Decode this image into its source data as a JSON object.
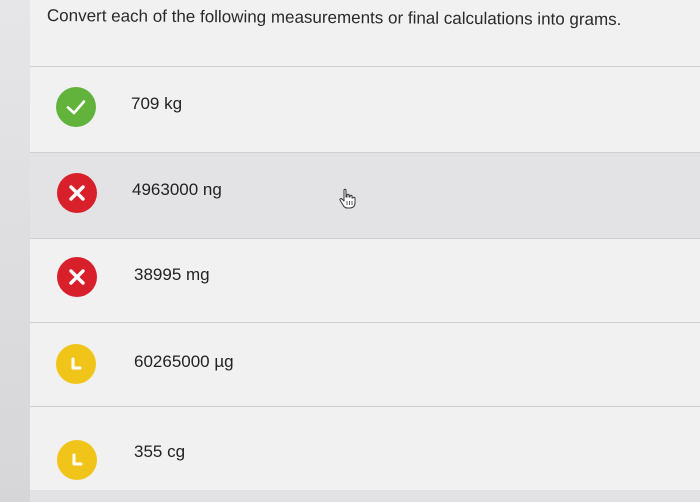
{
  "question": {
    "text": "Convert each of the following measurements or final calculations into grams."
  },
  "answers": [
    {
      "value": "709 kg",
      "status": "correct",
      "status_icon": "check-icon"
    },
    {
      "value": "4963000 ng",
      "status": "incorrect",
      "status_icon": "x-icon"
    },
    {
      "value": "38995 mg",
      "status": "incorrect",
      "status_icon": "x-icon"
    },
    {
      "value": "60265000 µg",
      "status": "partial",
      "status_icon": "partial-credit-icon"
    },
    {
      "value": "355 cg",
      "status": "partial",
      "status_icon": "partial-credit-icon"
    }
  ],
  "colors": {
    "correct": "#62b33b",
    "incorrect": "#d7202a",
    "partial": "#f0c419"
  },
  "cursor": {
    "icon": "hand-pointer-icon"
  }
}
